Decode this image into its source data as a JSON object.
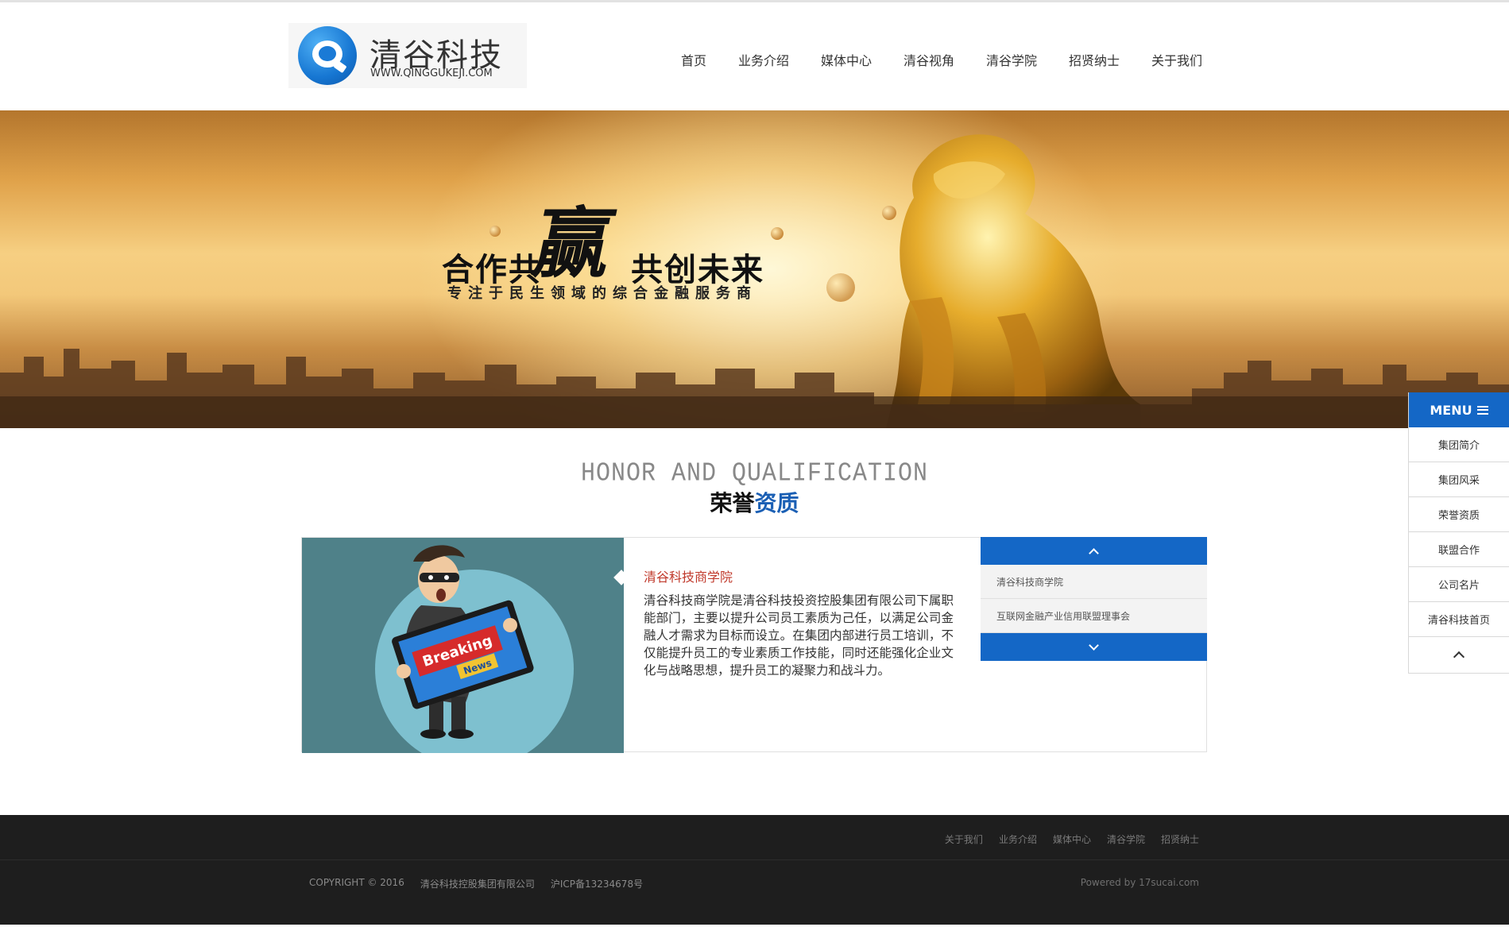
{
  "header": {
    "logo_title": "清谷科技",
    "logo_url": "WWW.QINGGUKEJI.COM",
    "nav": [
      "首页",
      "业务介绍",
      "媒体中心",
      "清谷视角",
      "清谷学院",
      "招贤纳士",
      "关于我们"
    ]
  },
  "banner": {
    "slogan_left": "合作共",
    "slogan_big": "赢",
    "slogan_right": "共创未来",
    "subslogan": "专注于民生领域的综合金融服务商"
  },
  "side_menu": {
    "title": "MENU",
    "items": [
      "集团简介",
      "集团风采",
      "荣誉资质",
      "联盟合作",
      "公司名片",
      "清谷科技首页"
    ]
  },
  "section": {
    "title_en": "HONOR AND QUALIFICATION",
    "title_zh_black": "荣誉",
    "title_zh_blue": "资质"
  },
  "panel": {
    "image_text_1": "Breaking",
    "image_text_2": "News",
    "title": "清谷科技商学院",
    "description": "清谷科技商学院是清谷科技投资控股集团有限公司下属职能部门，主要以提升公司员工素质为己任，以满足公司金融人才需求为目标而设立。在集团内部进行员工培训，不仅能提升员工的专业素质工作技能，同时还能强化企业文化与战略思想，提升员工的凝聚力和战斗力。",
    "list": [
      "清谷科技商学院",
      "互联网金融产业信用联盟理事会"
    ]
  },
  "footer": {
    "links": [
      "关于我们",
      "业务介绍",
      "媒体中心",
      "清谷学院",
      "招贤纳士"
    ],
    "copyright": "COPYRIGHT © 2016",
    "company": "清谷科技控股集团有限公司",
    "icp": "沪ICP备13234678号",
    "powered": "Powered by 17sucai.com"
  },
  "colors": {
    "accent_blue": "#1467c6",
    "title_red": "#c0392b",
    "footer_bg": "#1e1e1e"
  }
}
